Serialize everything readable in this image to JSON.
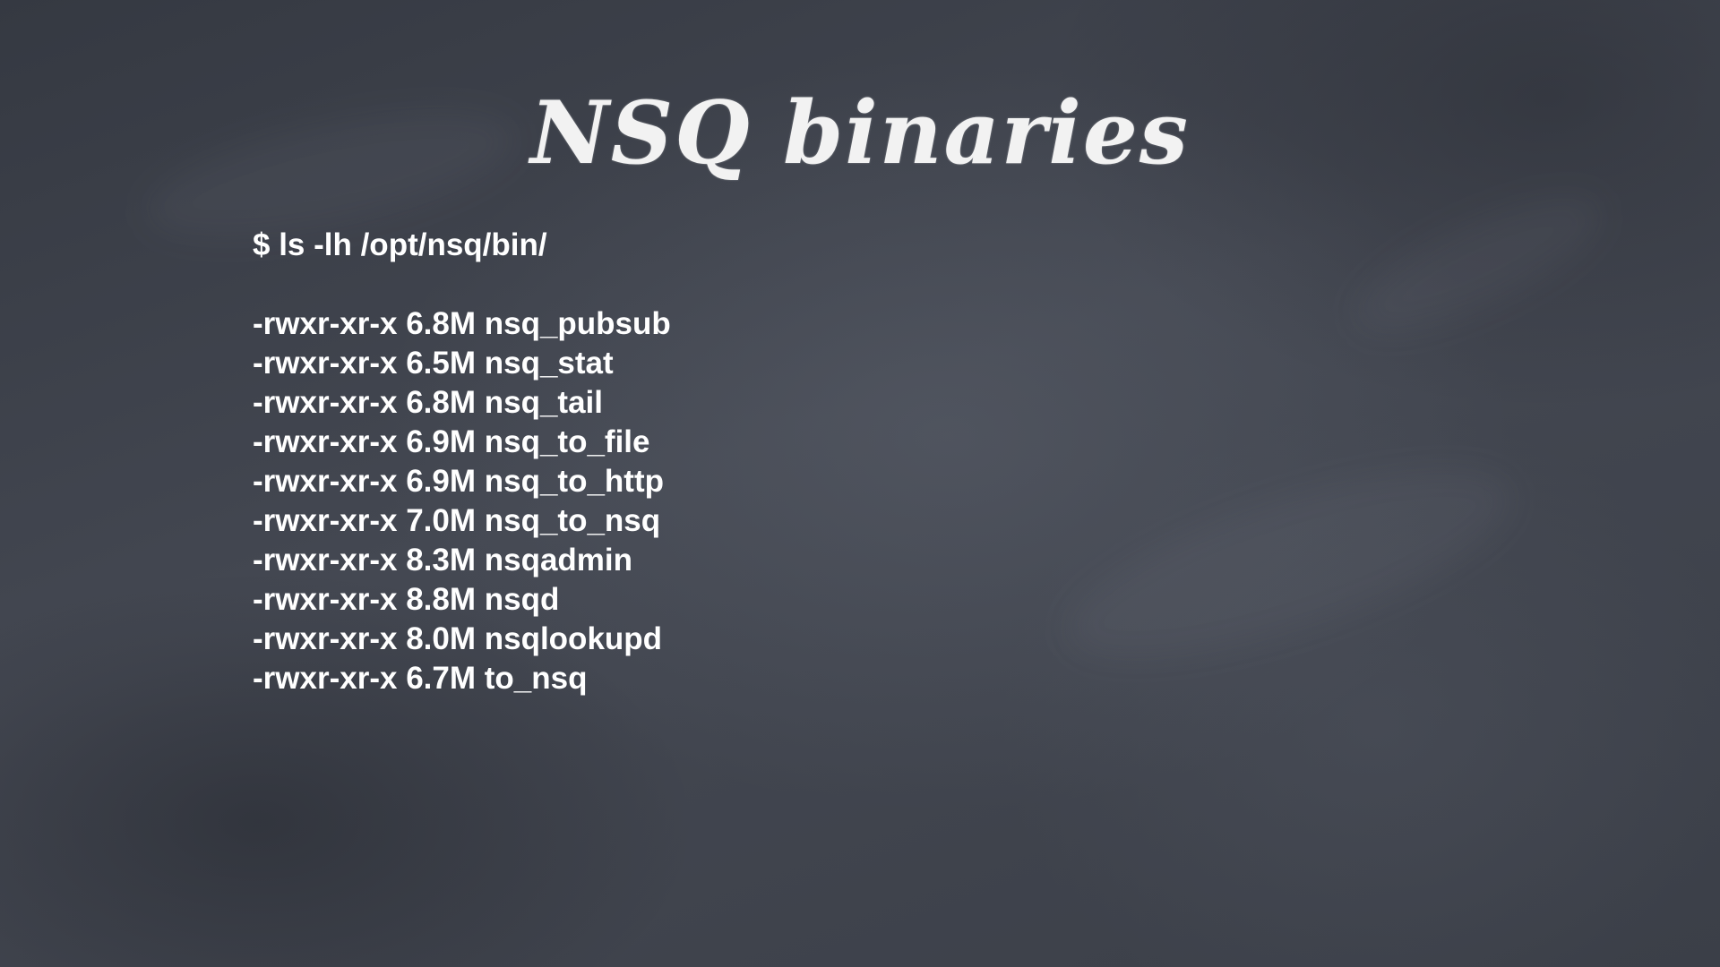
{
  "slide": {
    "title": "NSQ binaries",
    "command": "$ ls -lh /opt/nsq/bin/",
    "files": [
      {
        "perms": "-rwxr-xr-x",
        "size": "6.8M",
        "name": "nsq_pubsub"
      },
      {
        "perms": "-rwxr-xr-x",
        "size": "6.5M",
        "name": "nsq_stat"
      },
      {
        "perms": "-rwxr-xr-x",
        "size": "6.8M",
        "name": "nsq_tail"
      },
      {
        "perms": "-rwxr-xr-x",
        "size": "6.9M",
        "name": "nsq_to_file"
      },
      {
        "perms": "-rwxr-xr-x",
        "size": "6.9M",
        "name": "nsq_to_http"
      },
      {
        "perms": "-rwxr-xr-x",
        "size": "7.0M",
        "name": "nsq_to_nsq"
      },
      {
        "perms": "-rwxr-xr-x",
        "size": "8.3M",
        "name": "nsqadmin"
      },
      {
        "perms": "-rwxr-xr-x",
        "size": "8.8M",
        "name": "nsqd"
      },
      {
        "perms": "-rwxr-xr-x",
        "size": "8.0M",
        "name": "nsqlookupd"
      },
      {
        "perms": "-rwxr-xr-x",
        "size": "6.7M",
        "name": "to_nsq"
      }
    ]
  },
  "colors": {
    "background": "#3d414b",
    "text": "#ffffff"
  }
}
